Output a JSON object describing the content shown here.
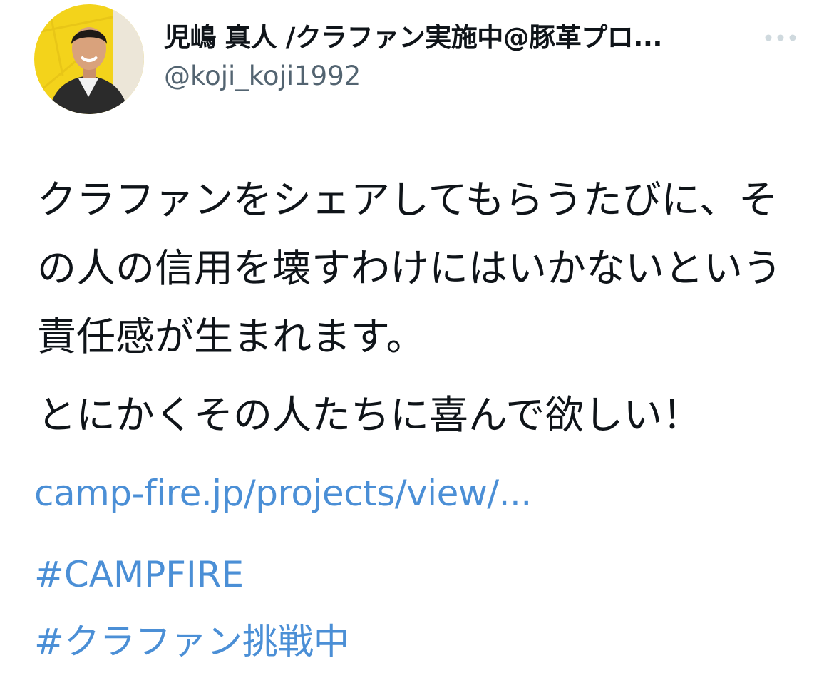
{
  "tweet": {
    "author": {
      "display_name": "児嶋 真人 /クラファン実施中@豚革プロ...",
      "handle": "@koji_koji1992",
      "avatar_icon": "profile-photo"
    },
    "more_icon": "ellipsis-icon",
    "body": {
      "paragraphs": [
        "クラファンをシェアしてもらうたびに、その人の信用を壊すわけにはいかないという責任感が生まれます。",
        "とにかくその人たちに喜んで欲しい！"
      ]
    },
    "link": "camp-fire.jp/projects/view/...",
    "hashtags": [
      "#CAMPFIRE",
      "#クラファン挑戦中"
    ]
  },
  "colors": {
    "text": "#0f1419",
    "secondary_text": "#536471",
    "link": "#4b8fd6",
    "more_icon": "#cfd9de",
    "avatar_background": "#f3d31b"
  }
}
